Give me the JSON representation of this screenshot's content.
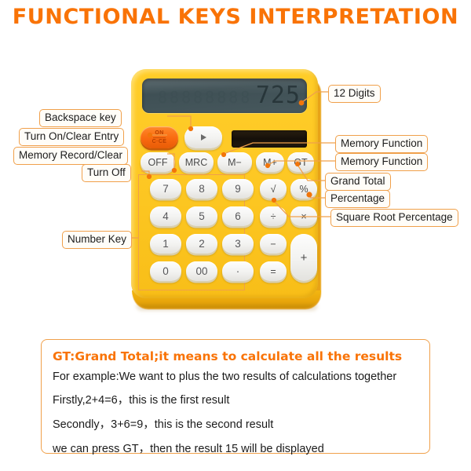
{
  "page": {
    "title": "FUNCTIONAL KEYS INTERPRETATION",
    "accent_color": "#F97306",
    "callout_border_color": "#F0A04B",
    "body_color": "#FFC926"
  },
  "callouts": {
    "left": [
      {
        "id": "backspace-key",
        "label": "Backspace key"
      },
      {
        "id": "turn-on-clear-entry",
        "label": "Turn On/Clear Entry"
      },
      {
        "id": "memory-record-clear",
        "label": "Memory Record/Clear"
      },
      {
        "id": "turn-off",
        "label": "Turn Off"
      },
      {
        "id": "number-key",
        "label": "Number Key"
      }
    ],
    "right": [
      {
        "id": "twelve-digits",
        "label": "12 Digits"
      },
      {
        "id": "memory-function-minus",
        "label": "Memory Function"
      },
      {
        "id": "memory-function-plus",
        "label": "Memory Function"
      },
      {
        "id": "grand-total",
        "label": "Grand Total"
      },
      {
        "id": "percentage",
        "label": "Percentage"
      },
      {
        "id": "square-root-percentage",
        "label": "Square Root Percentage"
      }
    ]
  },
  "calculator": {
    "display": {
      "digits": "725",
      "ghost": "88888888"
    },
    "solar_panel": "solar-panel",
    "function_keys": {
      "on_ce_line1": "ON",
      "on_ce_line2": "C·CE",
      "backspace": "▶",
      "off": "OFF",
      "mrc": "MRC",
      "m_minus": "M−",
      "m_plus": "M+",
      "gt": "GT"
    },
    "keypad": {
      "rows": [
        [
          "7",
          "8",
          "9"
        ],
        [
          "4",
          "5",
          "6"
        ],
        [
          "1",
          "2",
          "3"
        ],
        [
          "0",
          "00",
          "·"
        ]
      ]
    },
    "operator_keys": {
      "sqrt": "√",
      "percent": "%",
      "divide": "÷",
      "multiply": "×",
      "minus": "−",
      "equals": "=",
      "plus": "+"
    }
  },
  "info_box": {
    "heading": "GT:Grand Total;it means to calculate all the results",
    "lines": [
      "For example:We want to plus the two  results of calculations together",
      "Firstly,2+4=6，this is the first result",
      "Secondly，3+6=9，this is the second result",
      "we can press GT，then the result 15 will be displayed"
    ]
  }
}
